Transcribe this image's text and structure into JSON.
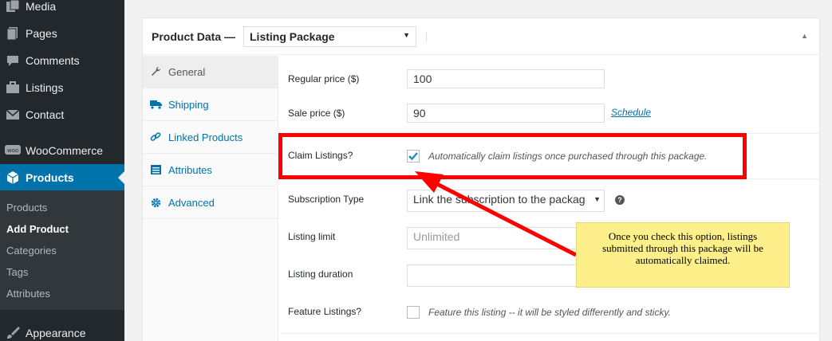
{
  "sidebar": {
    "items": [
      {
        "label": "Media",
        "icon": "media-icon"
      },
      {
        "label": "Pages",
        "icon": "pages-icon"
      },
      {
        "label": "Comments",
        "icon": "comments-icon"
      },
      {
        "label": "Listings",
        "icon": "briefcase-icon"
      },
      {
        "label": "Contact",
        "icon": "mail-icon"
      },
      {
        "label": "WooCommerce",
        "icon": "woocommerce-icon"
      },
      {
        "label": "Products",
        "icon": "products-icon"
      },
      {
        "label": "Appearance",
        "icon": "brush-icon"
      }
    ],
    "submenu": [
      "Products",
      "Add Product",
      "Categories",
      "Tags",
      "Attributes"
    ],
    "active_item": "Products",
    "active_submenu": "Add Product",
    "accent_color": "#0073aa"
  },
  "product_data": {
    "title": "Product Data —",
    "type_select_value": "Listing Package",
    "tabs": [
      "General",
      "Shipping",
      "Linked Products",
      "Attributes",
      "Advanced"
    ],
    "active_tab": "General",
    "fields": {
      "regular_price_label": "Regular price ($)",
      "regular_price_value": "100",
      "sale_price_label": "Sale price ($)",
      "sale_price_value": "90",
      "schedule_link": "Schedule",
      "claim_label": "Claim Listings?",
      "claim_checked": true,
      "claim_desc": "Automatically claim listings once purchased through this package.",
      "subscription_label": "Subscription Type",
      "subscription_value": "Link the subscription to the packag",
      "listing_limit_label": "Listing limit",
      "listing_limit_placeholder": "Unlimited",
      "listing_duration_label": "Listing duration",
      "listing_duration_value": "",
      "feature_label": "Feature Listings?",
      "feature_checked": false,
      "feature_desc": "Feature this listing -- it will be styled differently and sticky."
    }
  },
  "annotation": {
    "callout_text": "Once you check this option, listings submitted through this package will be automatically claimed.",
    "highlight_color": "#ff0000",
    "callout_color": "#fdf08a"
  }
}
